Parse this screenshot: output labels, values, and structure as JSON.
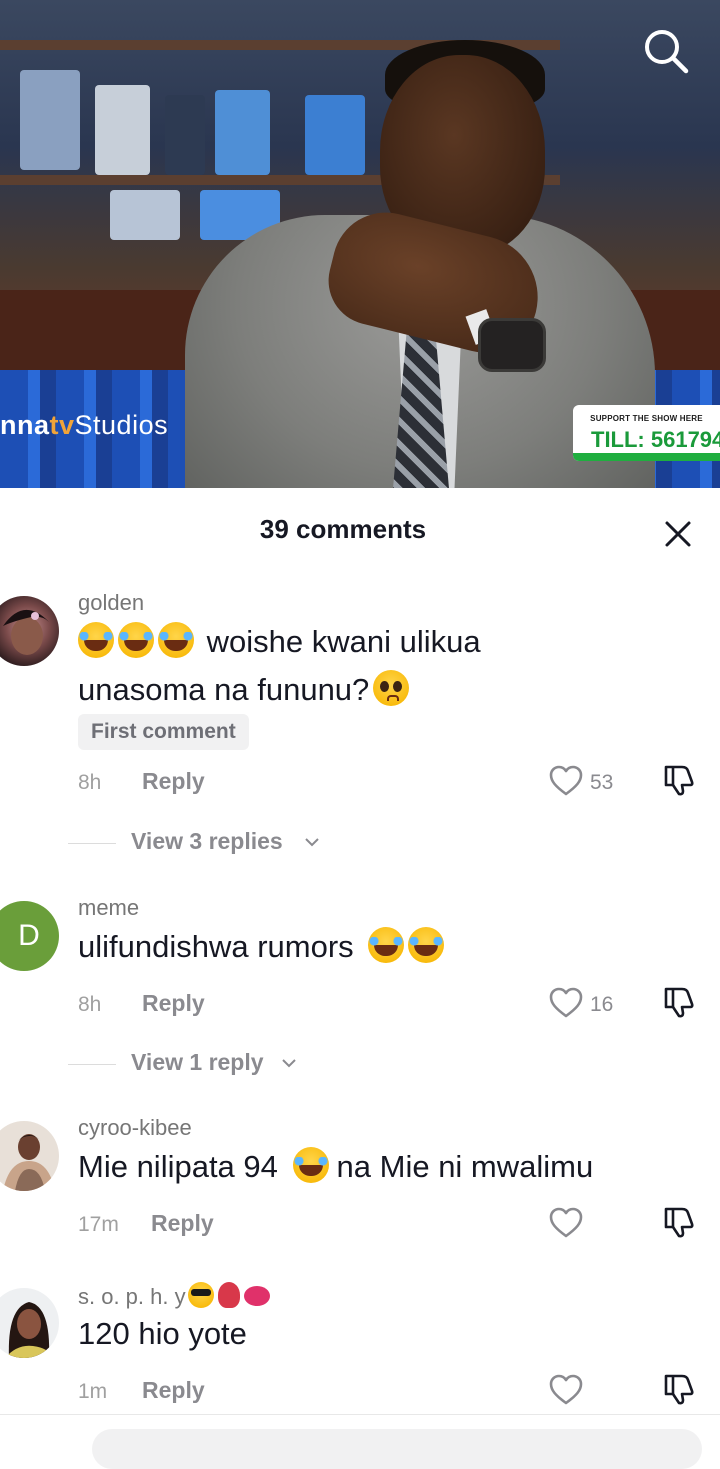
{
  "video": {
    "channel_logo": {
      "prefix": "nna",
      "tv": "tv",
      "studios": "Studios"
    },
    "banner": {
      "top_line": "SUPPORT THE SHOW HERE",
      "till": "TILL: 561794"
    },
    "search_icon": "search-icon"
  },
  "sheet": {
    "title": "39 comments",
    "close_icon": "close-icon",
    "comments": [
      {
        "username": "golden",
        "text_part1": "woishe kwani ulikua",
        "text_part2": "unasoma na fununu?",
        "badge": "First comment",
        "time": "8h",
        "reply_label": "Reply",
        "likes": "53",
        "view_replies": "View 3 replies"
      },
      {
        "username": "meme",
        "avatar_letter": "D",
        "avatar_color": "#6a9e3a",
        "text": "ulifundishwa rumors",
        "time": "8h",
        "reply_label": "Reply",
        "likes": "16",
        "view_replies": "View 1 reply"
      },
      {
        "username": "cyroo-kibee",
        "text_part1": "Mie nilipata 94",
        "text_part2": "na Mie ni mwalimu",
        "time": "17m",
        "reply_label": "Reply"
      },
      {
        "username": "s. o. p. h. y",
        "text": "120 hio yote",
        "time": "1m",
        "reply_label": "Reply"
      }
    ]
  },
  "colors": {
    "text_primary": "#161823",
    "text_secondary": "#8a8a8f",
    "badge_bg": "#f1f1f2"
  }
}
